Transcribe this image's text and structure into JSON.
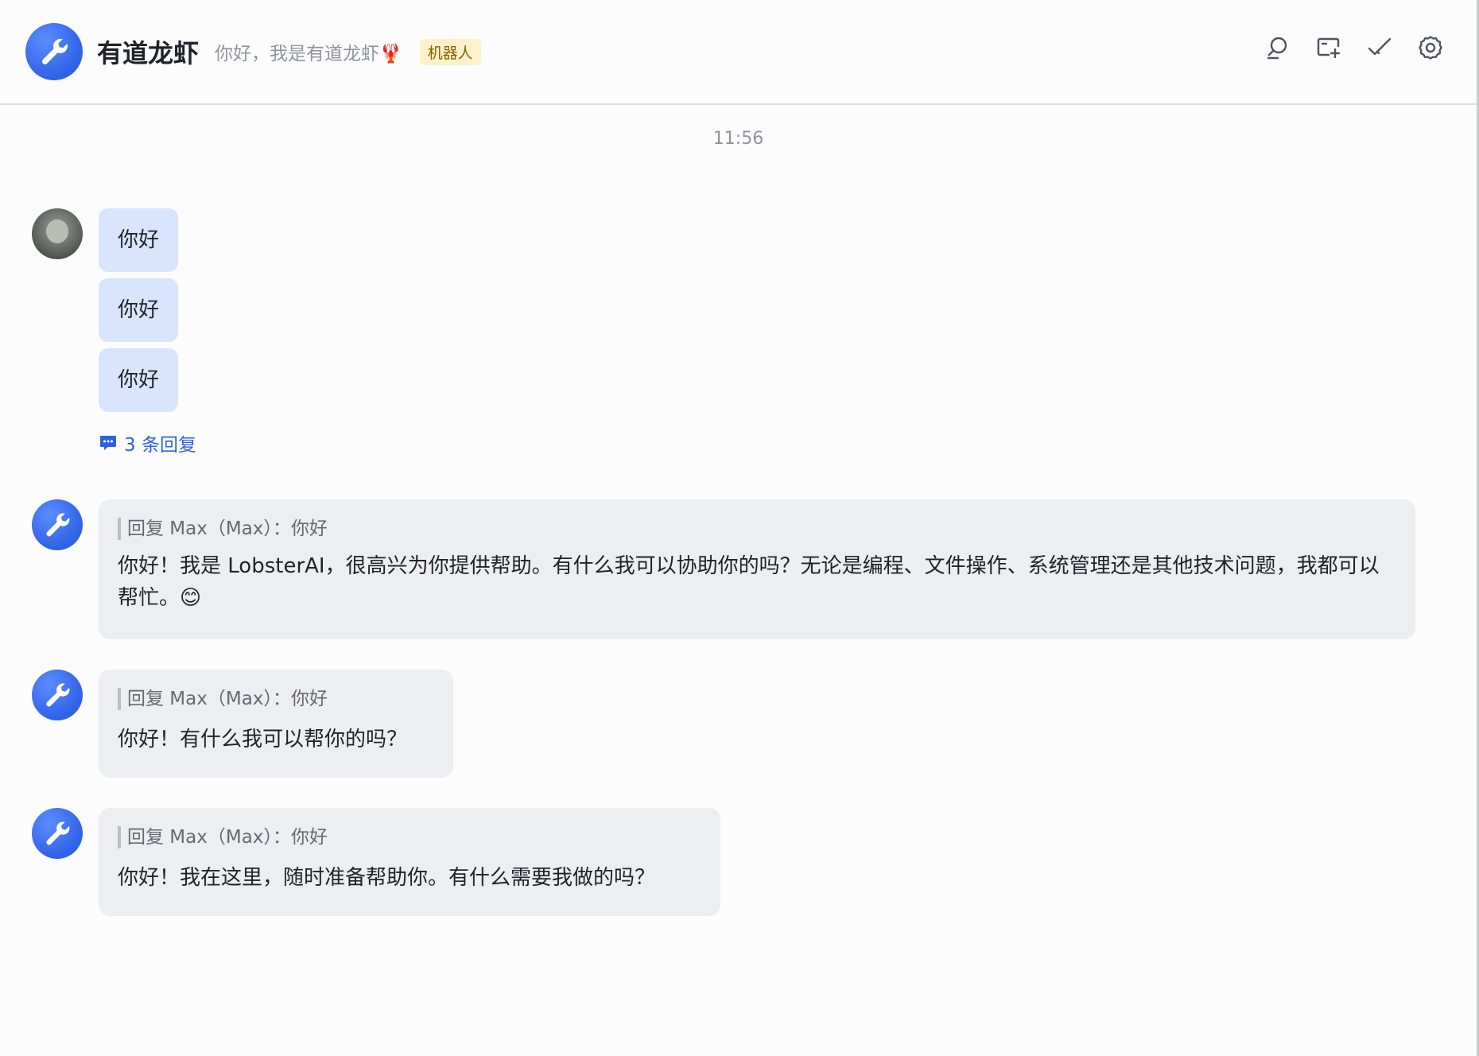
{
  "header": {
    "title": "有道龙虾",
    "subtitle": "你好，我是有道龙虾🦞",
    "badge": "机器人",
    "actions": [
      "search-icon",
      "add-to-group-icon",
      "mark-done-icon",
      "settings-icon"
    ]
  },
  "timestamp": "11:56",
  "user_messages": [
    "你好",
    "你好",
    "你好"
  ],
  "thread_reply": "3 条回复",
  "bot_replies": [
    {
      "quote": "回复 Max（Max）：你好",
      "text": "你好！我是 LobsterAI，很高兴为你提供帮助。有什么我可以协助你的吗？无论是编程、文件操作、系统管理还是其他技术问题，我都可以帮忙。😊"
    },
    {
      "quote": "回复 Max（Max）：你好",
      "text": "你好！有什么我可以帮你的吗？"
    },
    {
      "quote": "回复 Max（Max）：你好",
      "text": "你好！我在这里，随时准备帮助你。有什么需要我做的吗？"
    }
  ],
  "colors": {
    "accent": "#2d63e0",
    "user_bubble": "#d9e5fd",
    "bot_bubble": "#eceef1",
    "badge_bg": "#fdf1cc"
  }
}
